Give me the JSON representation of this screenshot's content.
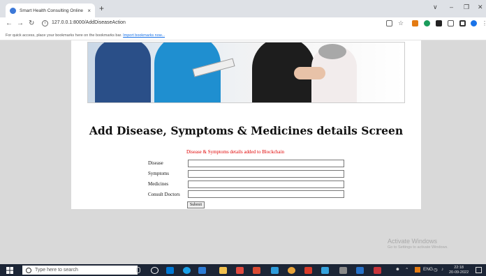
{
  "browser": {
    "tab_title": "Smart Health Consulting Online",
    "tab_close": "×",
    "new_tab": "+",
    "url": "127.0.0.1:8000/AddDiseaseAction",
    "bookmarks_text": "For quick access, place your bookmarks here on the bookmarks bar.",
    "bookmarks_link": "Import bookmarks now..."
  },
  "page": {
    "title": "Add Disease, Symptoms & Medicines details Screen",
    "status_message": "Disease & Symptoms details added to Blockchain",
    "form": {
      "fields": [
        {
          "label": "Disease",
          "value": ""
        },
        {
          "label": "Symptoms",
          "value": ""
        },
        {
          "label": "Medicines",
          "value": ""
        },
        {
          "label": "Consult Doctors",
          "value": ""
        }
      ],
      "submit_label": "Submit"
    }
  },
  "watermark": {
    "line1": "Activate Windows",
    "line2": "Go to Settings to activate Windows."
  },
  "taskbar": {
    "search_placeholder": "Type here to search",
    "clock_time": "22:18",
    "clock_date": "20-09-2022",
    "tray_text": "ENG"
  },
  "colors": {
    "status": "#e00000",
    "accent": "#1a73e8",
    "taskbar": "#1c2536"
  }
}
